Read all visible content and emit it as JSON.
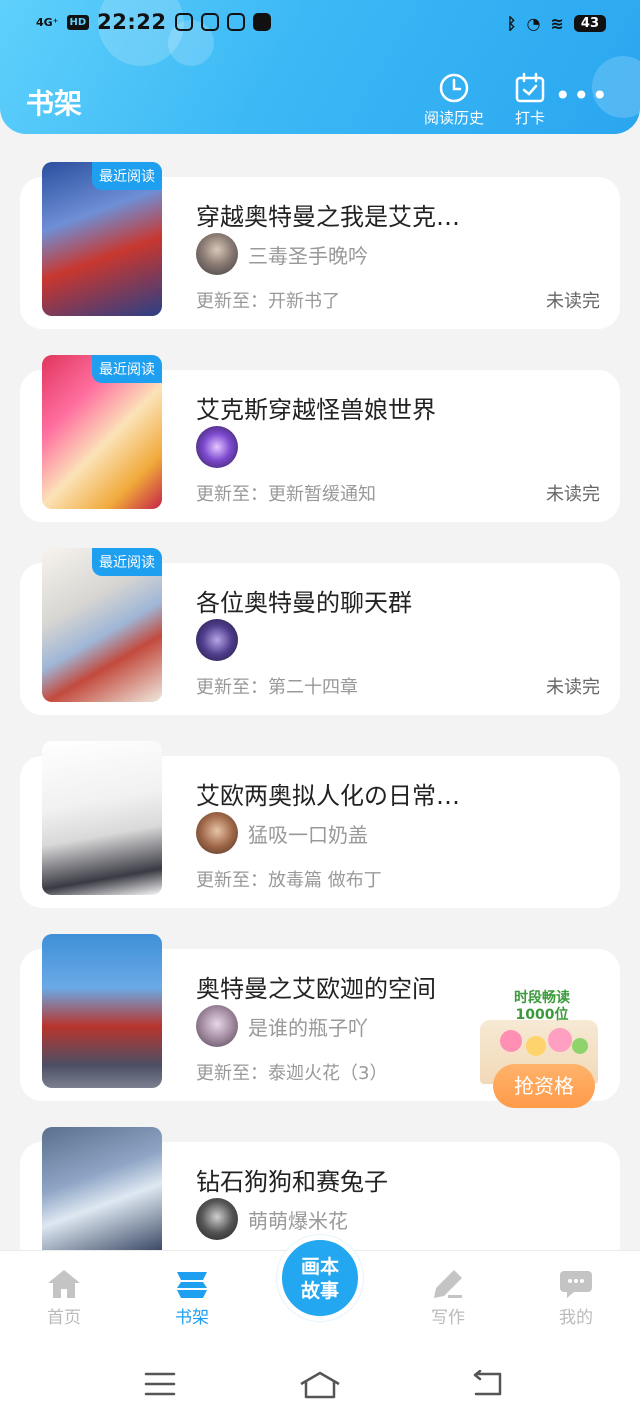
{
  "status_bar": {
    "network": "4G⁺",
    "hd": "HD",
    "time": "22:22",
    "battery": "43"
  },
  "header": {
    "title": "书架",
    "history_label": "阅读历史",
    "checkin_label": "打卡",
    "more_icon": "more-dots-icon",
    "color_start": "#5fd0fb",
    "color_end": "#2aa6f0"
  },
  "books": [
    {
      "title": "穿越奥特曼之我是艾克…",
      "author": "三毒圣手晚吟",
      "update": "更新至：开新书了",
      "status": "未读完",
      "tag": "最近阅读"
    },
    {
      "title": "艾克斯穿越怪兽娘世界",
      "author": "",
      "update": "更新至：更新暂缓通知",
      "status": "未读完",
      "tag": "最近阅读"
    },
    {
      "title": "各位奥特曼的聊天群",
      "author": "",
      "update": "更新至：第二十四章",
      "status": "未读完",
      "tag": "最近阅读"
    },
    {
      "title": "艾欧两奥拟人化の日常…",
      "author": "猛吸一口奶盖",
      "update": "更新至：放毒篇 做布丁",
      "status": "",
      "tag": ""
    },
    {
      "title": "奥特曼之艾欧迦的空间",
      "author": "是谁的瓶子吖",
      "update": "更新至：泰迦火花（3）",
      "status": "",
      "tag": ""
    },
    {
      "title": "钻石狗狗和赛兔子",
      "author": "萌萌爆米花",
      "update": "",
      "status": "",
      "tag": ""
    }
  ],
  "promo": {
    "text_line1": "时段畅读",
    "text_line2": "1000位",
    "button": "抢资格"
  },
  "tabbar": {
    "home": "首页",
    "shelf": "书架",
    "center_line1": "画本",
    "center_line2": "故事",
    "write": "写作",
    "mine": "我的",
    "active_color": "#1e9ff0"
  }
}
